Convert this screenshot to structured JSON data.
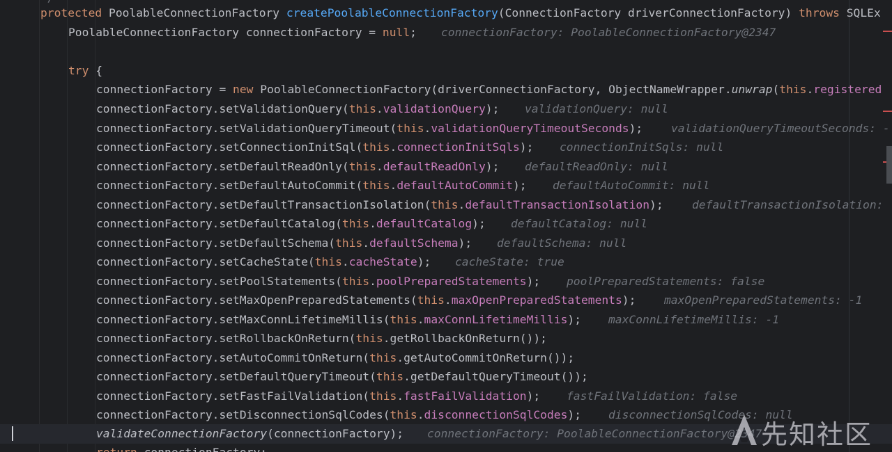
{
  "editor": {
    "top_fragment": "*/",
    "method_signature": {
      "modifier": "protected",
      "return_type": "PoolableConnectionFactory",
      "name": "createPoolableConnectionFactory",
      "params": "(ConnectionFactory driverConnectionFactory)",
      "throws_kw": "throws",
      "exception": "SQLEx"
    },
    "decl": {
      "type": "PoolableConnectionFactory connectionFactory = ",
      "null_kw": "null",
      "semicolon": ";",
      "hint": "connectionFactory: PoolableConnectionFactory@2347"
    },
    "try_kw": "try",
    "try_brace": " {",
    "new_line": {
      "lhs": "connectionFactory = ",
      "new_kw": "new",
      "rest": " PoolableConnectionFactory(driverConnectionFactory, ObjectNameWrapper.",
      "unwrap": "unwrap",
      "paren": "(",
      "this_kw": "this",
      "dot": ".",
      "field": "registered"
    },
    "calls": [
      {
        "method": "connectionFactory.setValidationQuery(",
        "arg_kind": "field",
        "arg": "validationQuery",
        "tail": ");",
        "hint": "validationQuery: null"
      },
      {
        "method": "connectionFactory.setValidationQueryTimeout(",
        "arg_kind": "field",
        "arg": "validationQueryTimeoutSeconds",
        "tail": ");",
        "hint": "validationQueryTimeoutSeconds: -"
      },
      {
        "method": "connectionFactory.setConnectionInitSql(",
        "arg_kind": "field",
        "arg": "connectionInitSqls",
        "tail": ");",
        "hint": "connectionInitSqls: null"
      },
      {
        "method": "connectionFactory.setDefaultReadOnly(",
        "arg_kind": "field",
        "arg": "defaultReadOnly",
        "tail": ");",
        "hint": "defaultReadOnly: null"
      },
      {
        "method": "connectionFactory.setDefaultAutoCommit(",
        "arg_kind": "field",
        "arg": "defaultAutoCommit",
        "tail": ");",
        "hint": "defaultAutoCommit: null"
      },
      {
        "method": "connectionFactory.setDefaultTransactionIsolation(",
        "arg_kind": "field",
        "arg": "defaultTransactionIsolation",
        "tail": ");",
        "hint": "defaultTransactionIsolation: "
      },
      {
        "method": "connectionFactory.setDefaultCatalog(",
        "arg_kind": "field",
        "arg": "defaultCatalog",
        "tail": ");",
        "hint": "defaultCatalog: null"
      },
      {
        "method": "connectionFactory.setDefaultSchema(",
        "arg_kind": "field",
        "arg": "defaultSchema",
        "tail": ");",
        "hint": "defaultSchema: null"
      },
      {
        "method": "connectionFactory.setCacheState(",
        "arg_kind": "field",
        "arg": "cacheState",
        "tail": ");",
        "hint": "cacheState: true"
      },
      {
        "method": "connectionFactory.setPoolStatements(",
        "arg_kind": "field",
        "arg": "poolPreparedStatements",
        "tail": ");",
        "hint": "poolPreparedStatements: false"
      },
      {
        "method": "connectionFactory.setMaxOpenPreparedStatements(",
        "arg_kind": "field",
        "arg": "maxOpenPreparedStatements",
        "tail": ");",
        "hint": "maxOpenPreparedStatements: -1"
      },
      {
        "method": "connectionFactory.setMaxConnLifetimeMillis(",
        "arg_kind": "field",
        "arg": "maxConnLifetimeMillis",
        "tail": ");",
        "hint": "maxConnLifetimeMillis: -1"
      },
      {
        "method": "connectionFactory.setRollbackOnReturn(",
        "arg_kind": "getter",
        "arg": "getRollbackOnReturn()",
        "tail": ");",
        "hint": ""
      },
      {
        "method": "connectionFactory.setAutoCommitOnReturn(",
        "arg_kind": "getter",
        "arg": "getAutoCommitOnReturn()",
        "tail": ");",
        "hint": ""
      },
      {
        "method": "connectionFactory.setDefaultQueryTimeout(",
        "arg_kind": "getter",
        "arg": "getDefaultQueryTimeout()",
        "tail": ");",
        "hint": ""
      },
      {
        "method": "connectionFactory.setFastFailValidation(",
        "arg_kind": "field",
        "arg": "fastFailValidation",
        "tail": ");",
        "hint": "fastFailValidation: false"
      },
      {
        "method": "connectionFactory.setDisconnectionSqlCodes(",
        "arg_kind": "field",
        "arg": "disconnectionSqlCodes",
        "tail": ");",
        "hint": "disconnectionSqlCodes: null"
      }
    ],
    "this_kw": "this",
    "dot": ".",
    "current_line": {
      "method": "validateConnectionFactory",
      "rest": "(connectionFactory);",
      "hint": "connectionFactory: PoolableConnectionFactory@2347"
    },
    "return_line": {
      "kw": "return",
      "rest": " connectionFactory;"
    }
  },
  "watermark": {
    "text": "先知社区",
    "icon": "xianzhi-logo-icon"
  },
  "colors": {
    "background": "#1e1f22",
    "keyword": "#cf8e6d",
    "declaration": "#56a8f5",
    "field": "#c77dbb",
    "text": "#bcbec4",
    "hint": "#6f737a",
    "current_line": "#26282e",
    "error_mark": "#c94f4f"
  }
}
